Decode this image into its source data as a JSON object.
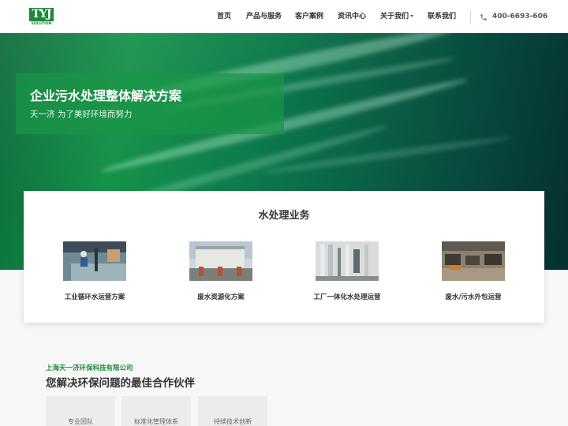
{
  "header": {
    "logo_text": "TYJ",
    "logo_sub": "SOLUTION",
    "nav": [
      "首页",
      "产品与服务",
      "客户案例",
      "资讯中心",
      "关于我们",
      "联系我们"
    ],
    "phone": "400-6693-606"
  },
  "hero": {
    "title": "企业污水处理整体解决方案",
    "subtitle": "天一济 为了美好环境而努力"
  },
  "services": {
    "title": "水处理业务",
    "items": [
      {
        "label": "工业循环水运营方案"
      },
      {
        "label": "废水资源化方案"
      },
      {
        "label": "工厂一体化水处理运营"
      },
      {
        "label": "废水/污水外包运营"
      }
    ]
  },
  "about": {
    "company": "上海天一济环保科技有限公司",
    "tagline": "您解决环保问题的最佳合作伙伴",
    "features": [
      "专业团队",
      "标准化管理体系",
      "持续技术创新"
    ]
  },
  "colors": {
    "brand_green": "#1d8a3a",
    "hero_dark": "#05302e"
  }
}
